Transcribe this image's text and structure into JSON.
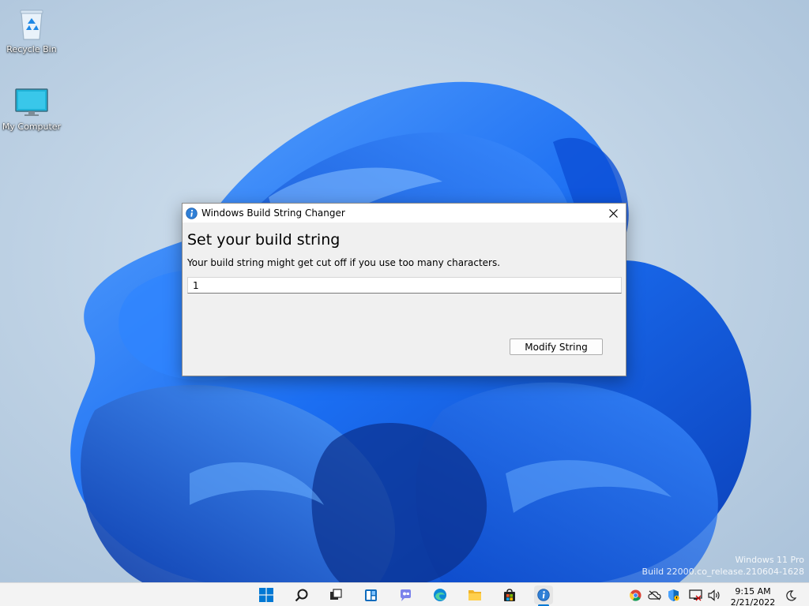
{
  "desktop": {
    "icons": [
      {
        "label": "Recycle Bin",
        "icon": "recycle-bin-icon"
      },
      {
        "label": "My Computer",
        "icon": "monitor-icon"
      }
    ],
    "watermark": {
      "line1": "Windows 11 Pro",
      "line2": "Build 22000.co_release.210604-1628"
    }
  },
  "dialog": {
    "title": "Windows Build String Changer",
    "title_icon": "info-icon",
    "heading": "Set your build string",
    "description": "Your build string might get cut off if you use too many characters.",
    "input_value": "1",
    "button_label": "Modify String"
  },
  "taskbar": {
    "apps": [
      "start-icon",
      "search-icon",
      "task-view-icon",
      "widgets-icon",
      "chat-icon",
      "edge-icon",
      "file-explorer-icon",
      "store-icon",
      "info-app-icon"
    ],
    "tray": [
      "chrome-icon",
      "onedrive-icon",
      "defender-icon",
      "network-icon",
      "volume-icon"
    ],
    "time": "9:15 AM",
    "date": "2/21/2022"
  },
  "colors": {
    "accent": "#0078d4",
    "wallpaper_bg": "#b7cde1",
    "bloom_blue": "#1e6ff0"
  }
}
